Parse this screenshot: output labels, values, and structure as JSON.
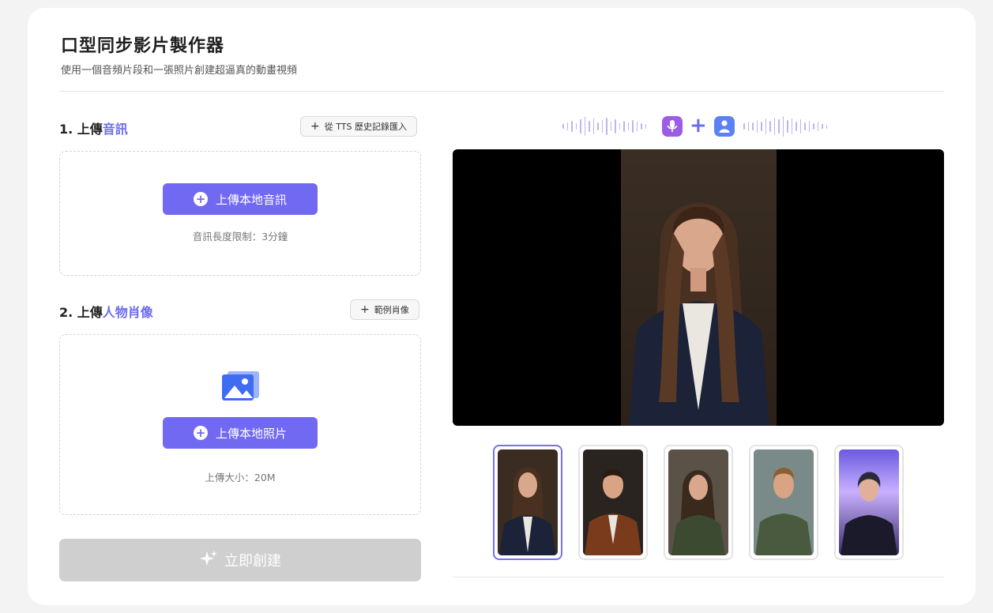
{
  "header": {
    "title": "口型同步影片製作器",
    "subtitle": "使用一個音頻片段和一張照片創建超逼真的動畫視頻"
  },
  "audio_step": {
    "title_prefix": "1. 上傳",
    "title_highlight": "音訊",
    "tts_import_label": "從 TTS 歷史記錄匯入",
    "upload_label": "上傳本地音訊",
    "hint": "音訊長度限制：3分鐘"
  },
  "portrait_step": {
    "title_prefix": "2. 上傳",
    "title_highlight": "人物肖像",
    "sample_label": "範例肖像",
    "upload_label": "上傳本地照片",
    "hint": "上傳大小：20M"
  },
  "create_label": "立即創建",
  "colors": {
    "accent": "#7269f2",
    "highlight_text": "#6b6bf0",
    "disabled_button": "#cfcfcf",
    "mic_chip": "#9b5de5",
    "user_chip": "#5b82f5"
  },
  "icons": {
    "header_mic": "microphone-icon",
    "header_user": "user-icon",
    "header_plus": "plus-icon",
    "portrait_upload": "image-icon",
    "create": "sparkle-icon"
  },
  "thumbnails": [
    {
      "name": "woman-navy-suit",
      "active": true
    },
    {
      "name": "man-brown-jacket",
      "active": false
    },
    {
      "name": "woman-olive-sweater",
      "active": false
    },
    {
      "name": "man-green-shirt",
      "active": false
    },
    {
      "name": "cyberpunk-woman",
      "active": false
    }
  ]
}
